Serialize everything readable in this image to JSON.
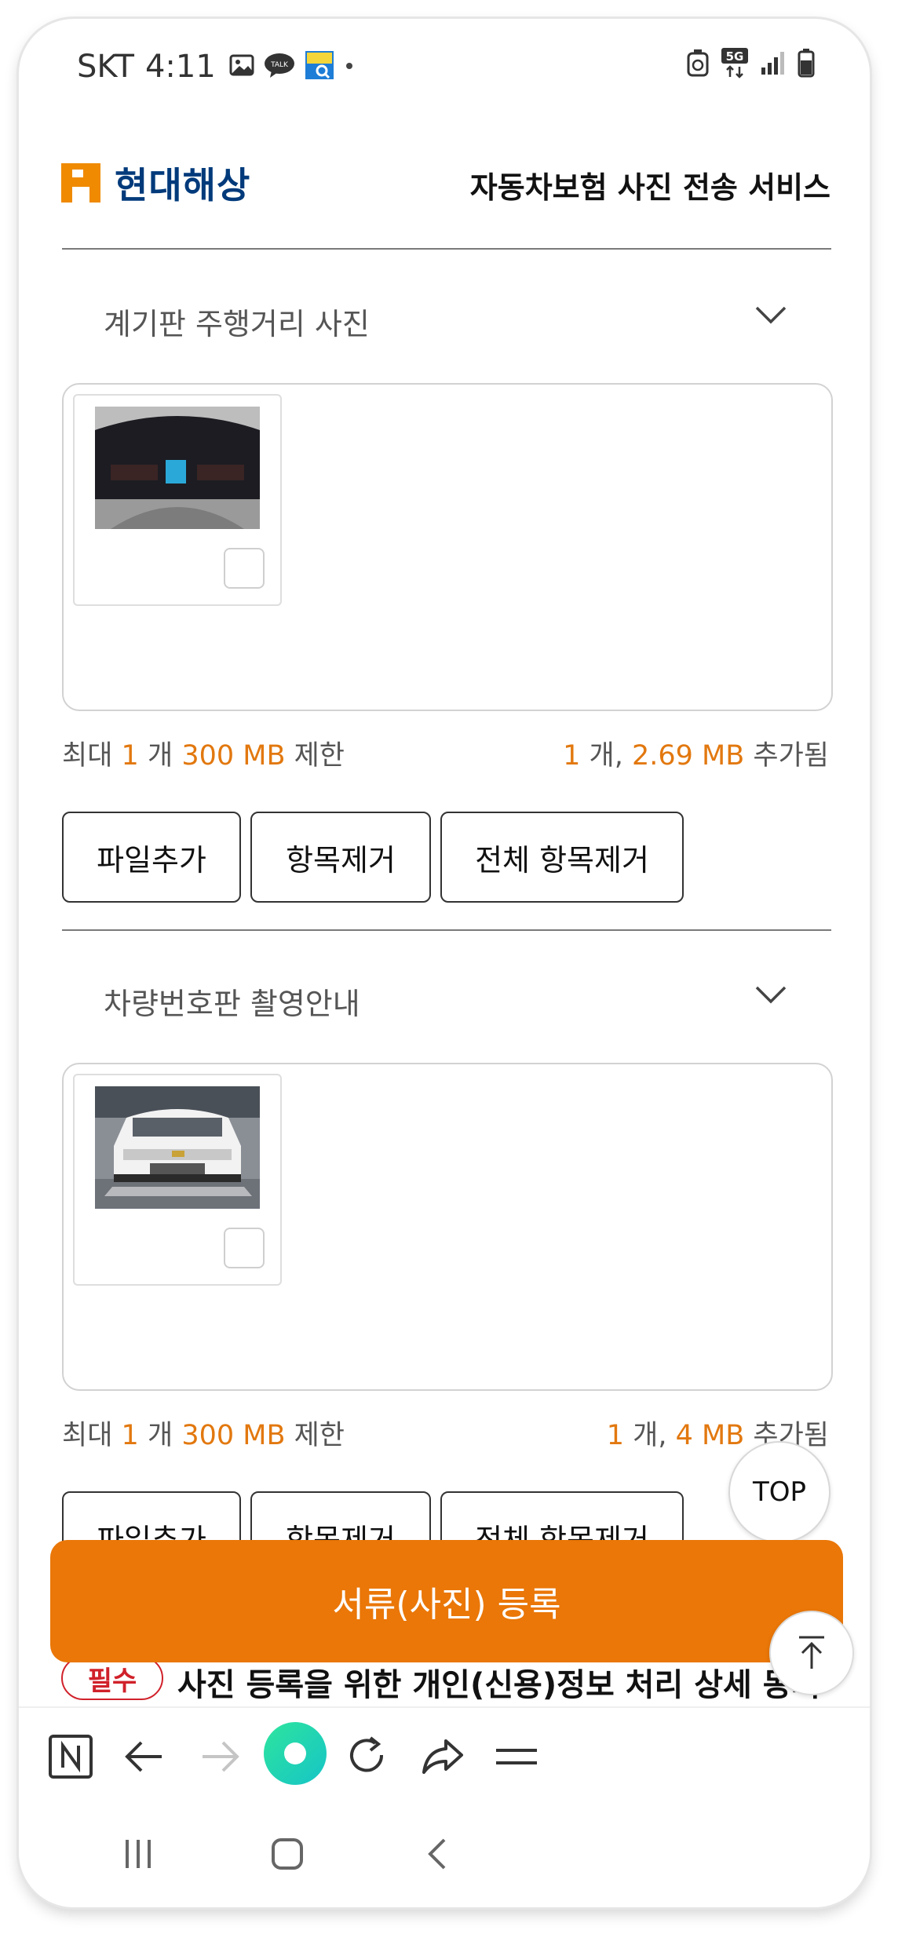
{
  "status_bar": {
    "carrier": "SKT",
    "time": "4:11",
    "kakaotalk_label": "TALK",
    "network": "5G"
  },
  "header": {
    "brand": "현대해상",
    "service_title": "자동차보험 사진 전송 서비스"
  },
  "sections": [
    {
      "title": "계기판 주행거리 사진",
      "limit": {
        "prefix": "최대",
        "count": "1",
        "count_unit": "개",
        "size": "300 MB",
        "suffix": "제한"
      },
      "added": {
        "count": "1",
        "count_unit": "개,",
        "size": "2.69 MB",
        "suffix": "추가됨"
      },
      "buttons": {
        "add": "파일추가",
        "remove": "항목제거",
        "remove_all": "전체 항목제거"
      }
    },
    {
      "title": "차량번호판 촬영안내",
      "limit": {
        "prefix": "최대",
        "count": "1",
        "count_unit": "개",
        "size": "300 MB",
        "suffix": "제한"
      },
      "added": {
        "count": "1",
        "count_unit": "개,",
        "size": "4 MB",
        "suffix": "추가됨"
      },
      "buttons": {
        "add": "파일추가",
        "remove": "항목제거",
        "remove_all": "전체 항목제거"
      }
    }
  ],
  "top_button": "TOP",
  "submit_button": "서류(사진) 등록",
  "consent": {
    "badge": "필수",
    "text": "사진 등록을 위한 개인(신용)정보 처리 상세 동의"
  },
  "colors": {
    "accent": "#ea7708",
    "brand_blue": "#003a7b",
    "required_red": "#d0212a"
  }
}
